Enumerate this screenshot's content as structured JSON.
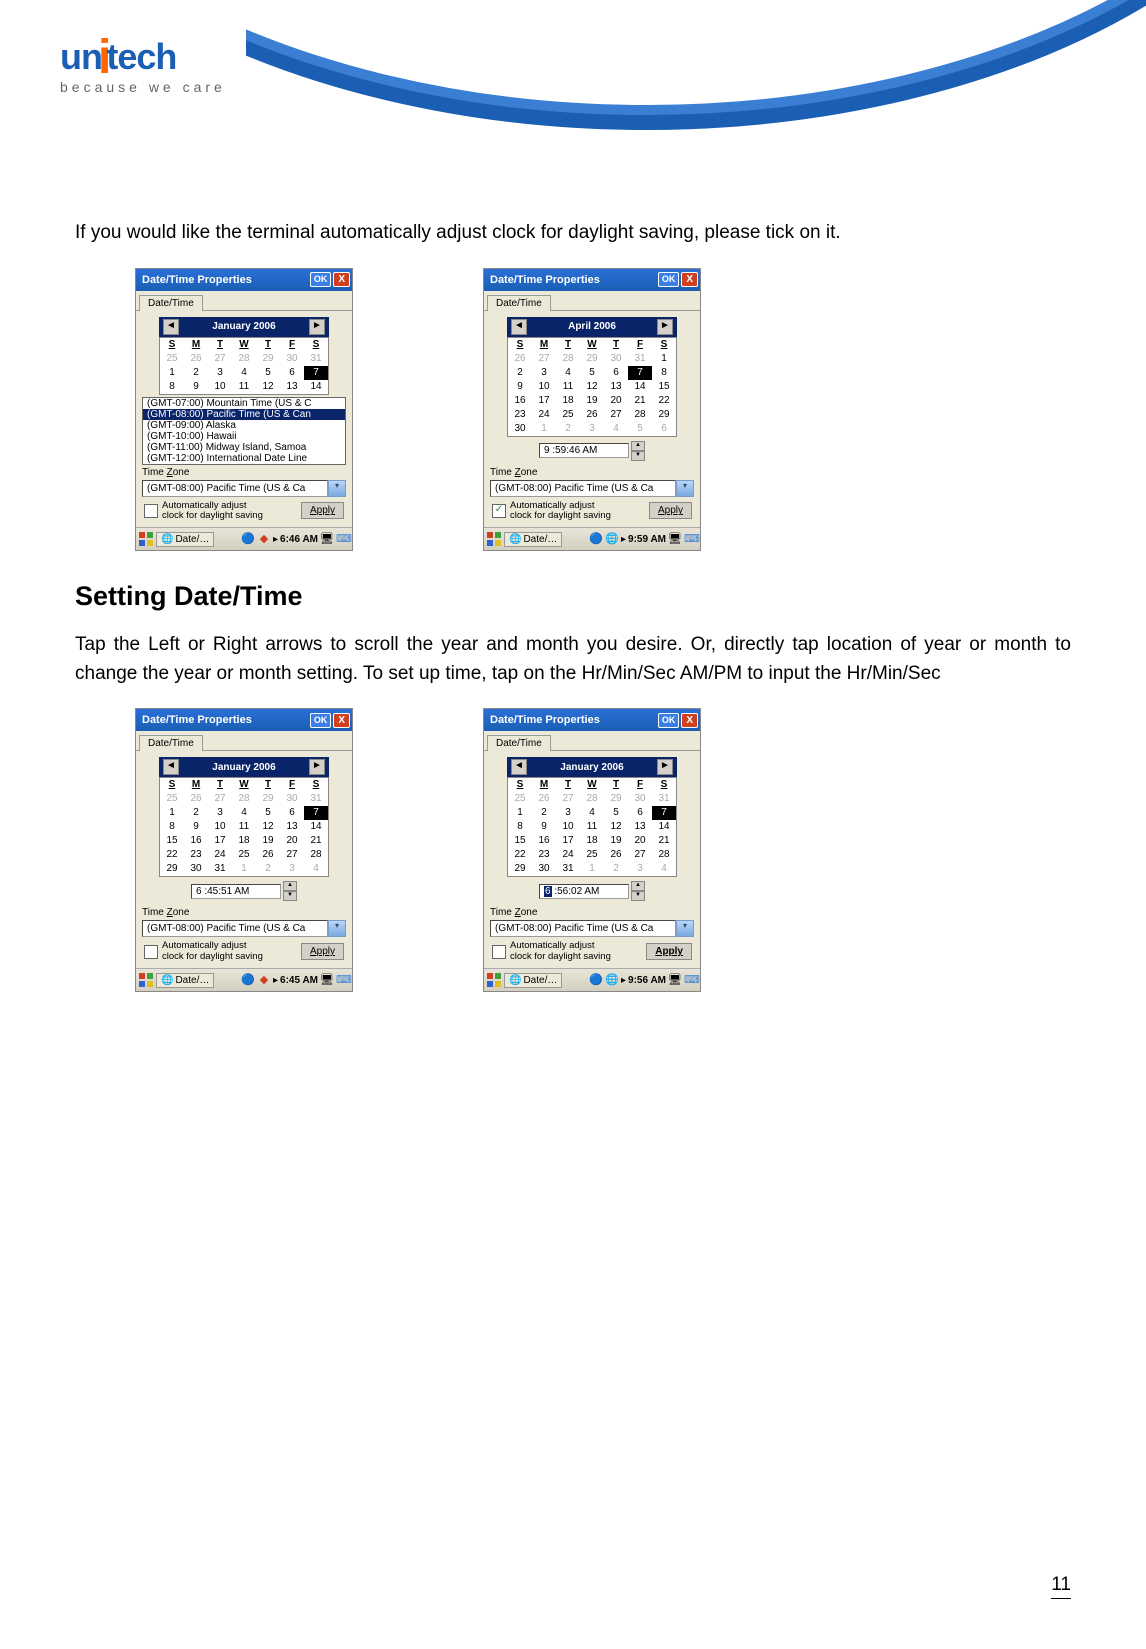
{
  "logo": {
    "brand": "unitech",
    "tagline": "because we care"
  },
  "intro": "If you would like the terminal automatically adjust clock for daylight saving, please tick on it.",
  "heading": "Setting Date/Time",
  "body2": "Tap the Left or Right arrows to scroll the year and month you desire. Or, directly tap location of year or month to change the year or month setting. To set up time, tap on the Hr/Min/Sec AM/PM to input the Hr/Min/Sec",
  "page_number": "11",
  "common": {
    "title": "Date/Time Properties",
    "ok": "OK",
    "tab": "Date/Time",
    "tz_label": "Time Zone",
    "tz_value": "(GMT-08:00) Pacific Time (US & Ca",
    "dst_text": "Automatically adjust clock for daylight saving",
    "apply": "Apply",
    "dow": [
      "S",
      "M",
      "T",
      "W",
      "T",
      "F",
      "S"
    ],
    "task": "Date/…"
  },
  "shot1": {
    "month": "January 2006",
    "grid": [
      [
        "25",
        "26",
        "27",
        "28",
        "29",
        "30",
        "31"
      ],
      [
        "1",
        "2",
        "3",
        "4",
        "5",
        "6",
        "7"
      ],
      [
        "8",
        "9",
        "10",
        "11",
        "12",
        "13",
        "14"
      ]
    ],
    "gray_rows": [
      0
    ],
    "sel": [
      1,
      6
    ],
    "tz_list": [
      "(GMT-07:00) Mountain Time (US & C",
      "(GMT-08:00) Pacific Time (US & Can",
      "(GMT-09:00) Alaska",
      "(GMT-10:00) Hawaii",
      "(GMT-11:00) Midway Island, Samoa",
      "(GMT-12:00) International Date Line"
    ],
    "tz_sel": 1,
    "dst_checked": false,
    "taskbar_time": "6:46 AM"
  },
  "shot2": {
    "month": "April 2006",
    "grid": [
      [
        "26",
        "27",
        "28",
        "29",
        "30",
        "31",
        "1"
      ],
      [
        "2",
        "3",
        "4",
        "5",
        "6",
        "7",
        "8"
      ],
      [
        "9",
        "10",
        "11",
        "12",
        "13",
        "14",
        "15"
      ],
      [
        "16",
        "17",
        "18",
        "19",
        "20",
        "21",
        "22"
      ],
      [
        "23",
        "24",
        "25",
        "26",
        "27",
        "28",
        "29"
      ],
      [
        "30",
        "1",
        "2",
        "3",
        "4",
        "5",
        "6"
      ]
    ],
    "gray_cells": [
      [
        0,
        0
      ],
      [
        0,
        1
      ],
      [
        0,
        2
      ],
      [
        0,
        3
      ],
      [
        0,
        4
      ],
      [
        0,
        5
      ],
      [
        5,
        1
      ],
      [
        5,
        2
      ],
      [
        5,
        3
      ],
      [
        5,
        4
      ],
      [
        5,
        5
      ],
      [
        5,
        6
      ]
    ],
    "sel": [
      1,
      5
    ],
    "time": "9 :59:46 AM",
    "dst_checked": true,
    "taskbar_time": "9:59 AM"
  },
  "shot3": {
    "month": "January 2006",
    "grid": [
      [
        "25",
        "26",
        "27",
        "28",
        "29",
        "30",
        "31"
      ],
      [
        "1",
        "2",
        "3",
        "4",
        "5",
        "6",
        "7"
      ],
      [
        "8",
        "9",
        "10",
        "11",
        "12",
        "13",
        "14"
      ],
      [
        "15",
        "16",
        "17",
        "18",
        "19",
        "20",
        "21"
      ],
      [
        "22",
        "23",
        "24",
        "25",
        "26",
        "27",
        "28"
      ],
      [
        "29",
        "30",
        "31",
        "1",
        "2",
        "3",
        "4"
      ]
    ],
    "gray_cells": [
      [
        0,
        0
      ],
      [
        0,
        1
      ],
      [
        0,
        2
      ],
      [
        0,
        3
      ],
      [
        0,
        4
      ],
      [
        0,
        5
      ],
      [
        0,
        6
      ],
      [
        5,
        3
      ],
      [
        5,
        4
      ],
      [
        5,
        5
      ],
      [
        5,
        6
      ]
    ],
    "sel": [
      1,
      6
    ],
    "time": "6 :45:51 AM",
    "dst_checked": false,
    "taskbar_time": "6:45 AM"
  },
  "shot4": {
    "month": "January 2006",
    "grid": [
      [
        "25",
        "26",
        "27",
        "28",
        "29",
        "30",
        "31"
      ],
      [
        "1",
        "2",
        "3",
        "4",
        "5",
        "6",
        "7"
      ],
      [
        "8",
        "9",
        "10",
        "11",
        "12",
        "13",
        "14"
      ],
      [
        "15",
        "16",
        "17",
        "18",
        "19",
        "20",
        "21"
      ],
      [
        "22",
        "23",
        "24",
        "25",
        "26",
        "27",
        "28"
      ],
      [
        "29",
        "30",
        "31",
        "1",
        "2",
        "3",
        "4"
      ]
    ],
    "gray_cells": [
      [
        0,
        0
      ],
      [
        0,
        1
      ],
      [
        0,
        2
      ],
      [
        0,
        3
      ],
      [
        0,
        4
      ],
      [
        0,
        5
      ],
      [
        0,
        6
      ],
      [
        5,
        3
      ],
      [
        5,
        4
      ],
      [
        5,
        5
      ],
      [
        5,
        6
      ]
    ],
    "sel": [
      1,
      6
    ],
    "time_pre_sel": "6",
    "time_post": " :56:02 AM",
    "dst_checked": false,
    "apply_bold": true,
    "taskbar_time": "9:56 AM"
  }
}
